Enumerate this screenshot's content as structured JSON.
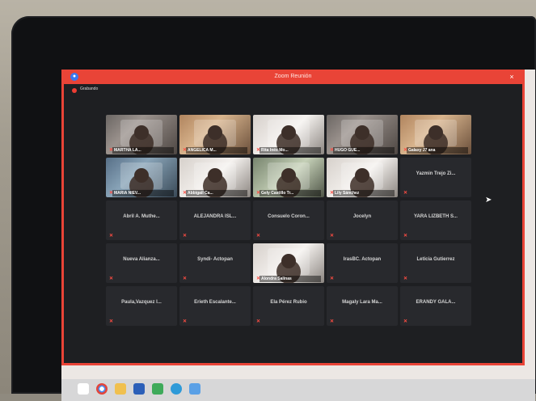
{
  "window": {
    "title": "Zoom Reunión",
    "recording_label": "Grabando"
  },
  "participants": [
    {
      "name": "MARTHA LA...",
      "kind": "video",
      "tone": "video"
    },
    {
      "name": "ANGELICA M...",
      "kind": "video",
      "tone": "warm"
    },
    {
      "name": "Rita Inés Mo...",
      "kind": "video",
      "tone": "pale"
    },
    {
      "name": "HUGO GUE...",
      "kind": "video",
      "tone": "video"
    },
    {
      "name": "Galaxy J7 ana",
      "kind": "video",
      "tone": "warm"
    },
    {
      "name": "MARIA NIEV...",
      "kind": "video",
      "tone": "blue"
    },
    {
      "name": "Abbigail Ca...",
      "kind": "video",
      "tone": "pale"
    },
    {
      "name": "Gely Castillo Tr...",
      "kind": "video",
      "tone": "green"
    },
    {
      "name": "Lily Sánchez",
      "kind": "video",
      "tone": "pale"
    },
    {
      "name": "Yazmin Trejo Zi...",
      "kind": "name"
    },
    {
      "name": "Abril A. Muthe...",
      "kind": "name"
    },
    {
      "name": "ALEJANDRA ISL...",
      "kind": "name"
    },
    {
      "name": "Consuelo Coron...",
      "kind": "name"
    },
    {
      "name": "Jocelyn",
      "kind": "name"
    },
    {
      "name": "YARA LIZBETH S...",
      "kind": "name"
    },
    {
      "name": "Nueva Alianza...",
      "kind": "name"
    },
    {
      "name": "Syndi- Actopan",
      "kind": "name"
    },
    {
      "name": "Alondra Salinas",
      "kind": "video",
      "tone": "pale"
    },
    {
      "name": "IrasBC. Actopan",
      "kind": "name"
    },
    {
      "name": "Leticia Gutierrez",
      "kind": "name"
    },
    {
      "name": "Paula,Vazquez I...",
      "kind": "name"
    },
    {
      "name": "Erieth Escalante...",
      "kind": "name"
    },
    {
      "name": "Ela Pérez Rubio",
      "kind": "name"
    },
    {
      "name": "Magaly Lara Ma...",
      "kind": "name"
    },
    {
      "name": "ERANDY GALA...",
      "kind": "name"
    }
  ],
  "taskbar": {
    "icons": [
      "start-icon",
      "chrome-icon",
      "folder-icon",
      "word-icon",
      "store-icon",
      "edge-icon",
      "zoom-icon"
    ]
  },
  "colors": {
    "zoom_red": "#e94437",
    "tile_dark": "#28292d",
    "muted_red": "#ff4d43",
    "window_bg": "#1e1f22"
  }
}
